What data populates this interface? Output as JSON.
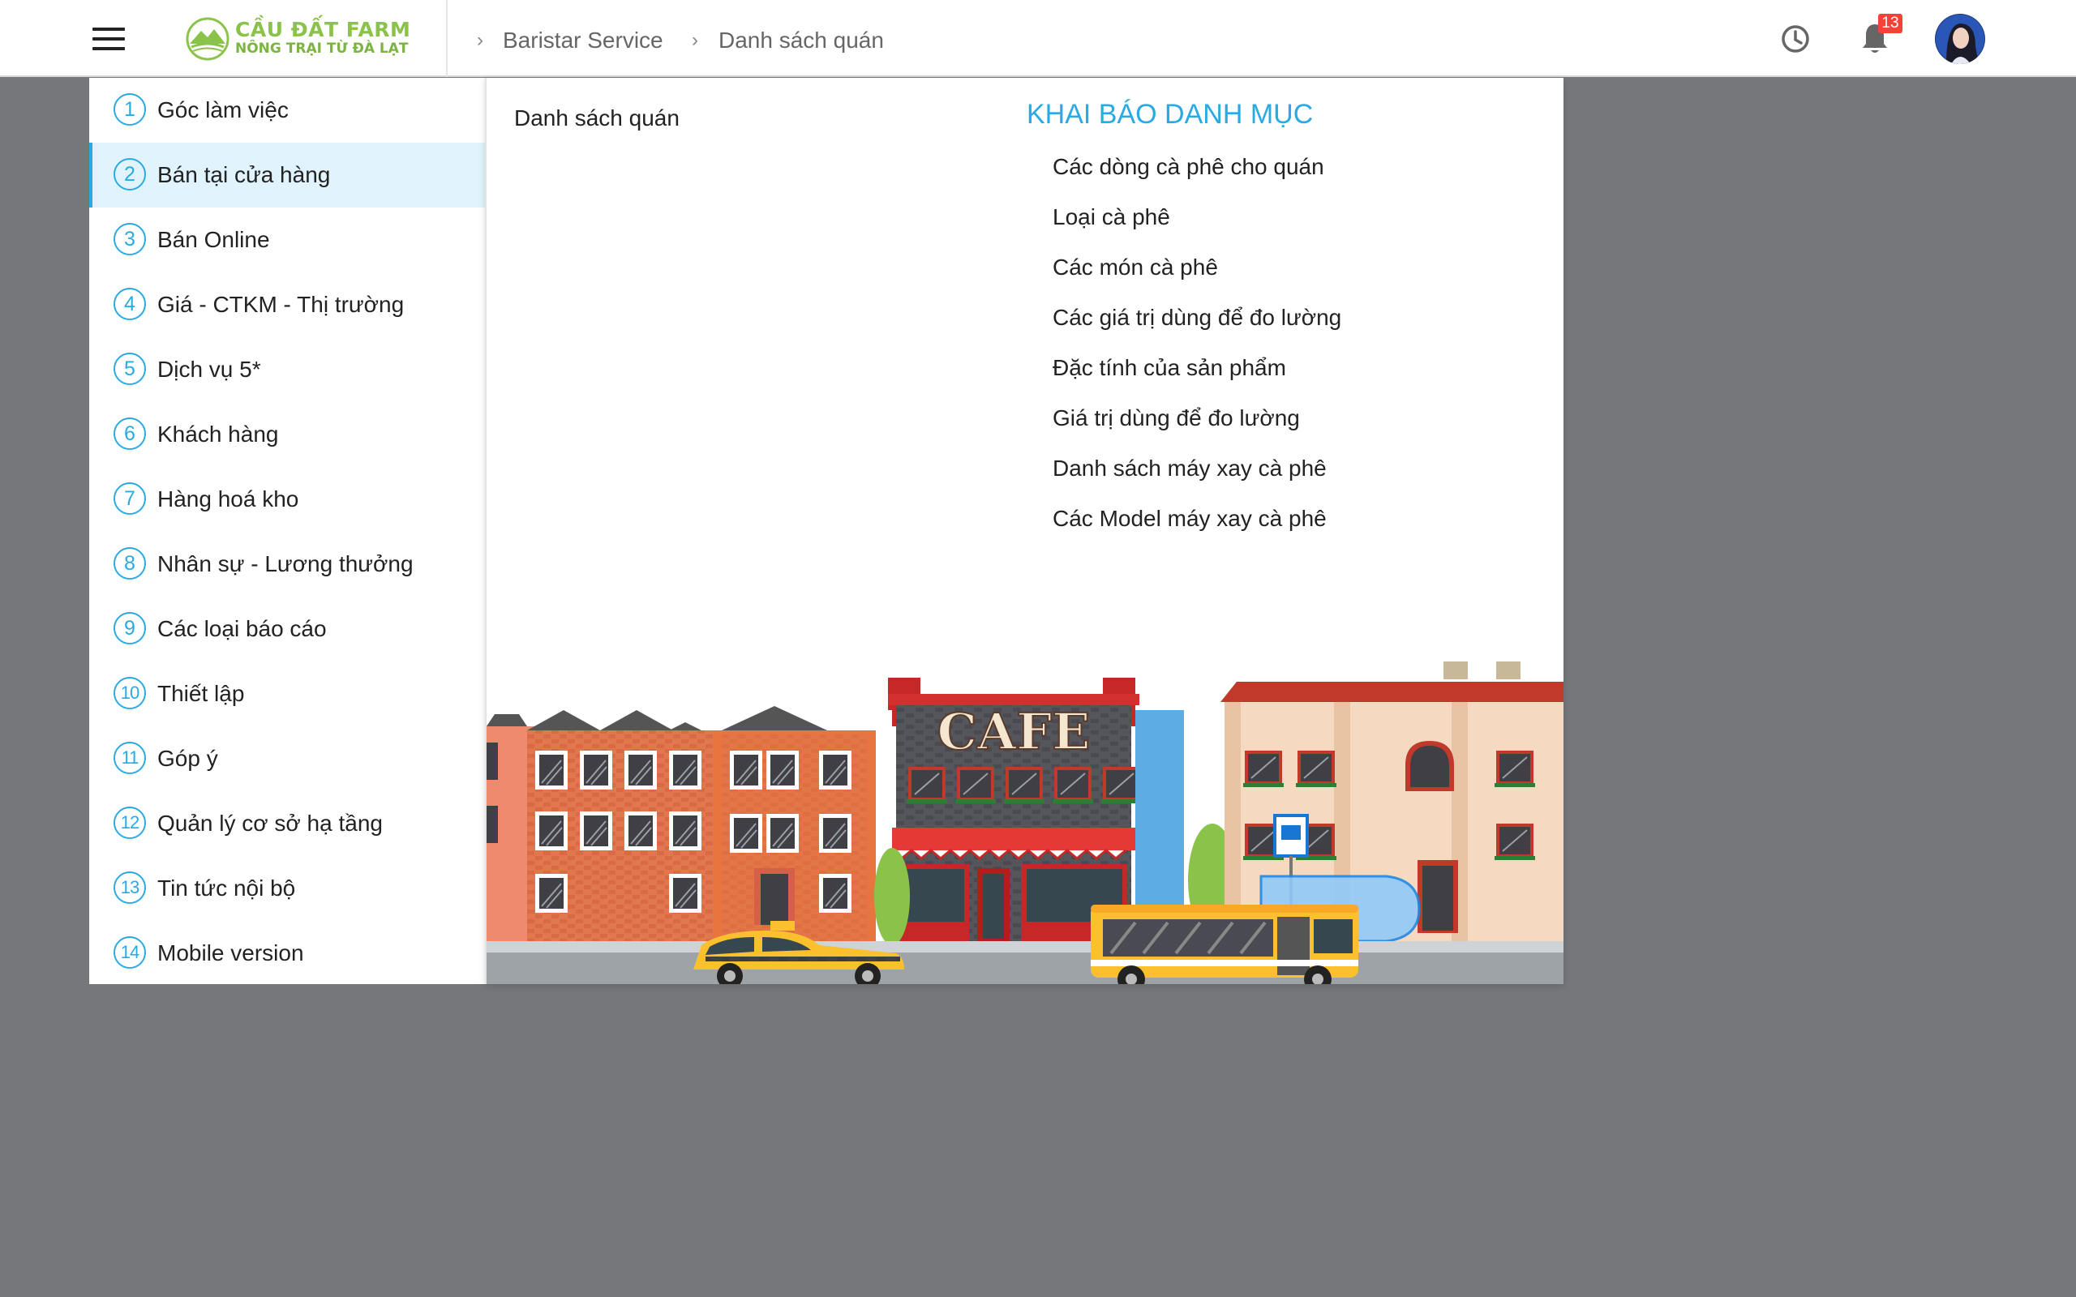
{
  "header": {
    "logo": {
      "name": "CẦU ĐẤT FARM",
      "tagline": "NÔNG TRẠI TỪ ĐÀ LẠT"
    },
    "breadcrumb": [
      "Baristar Service",
      "Danh sách quán"
    ],
    "icons": {
      "menu": "hamburger-menu-icon",
      "history": "clock-icon",
      "notifications": "bell-icon"
    },
    "notification_count": "13",
    "colors": {
      "brand_green": "#8bc34a",
      "badge": "#f44336"
    }
  },
  "sidebar": {
    "accent": "#29abe2",
    "active_index": 1,
    "items": [
      {
        "num": "1",
        "label": "Góc làm việc"
      },
      {
        "num": "2",
        "label": "Bán tại cửa hàng"
      },
      {
        "num": "3",
        "label": "Bán Online"
      },
      {
        "num": "4",
        "label": "Giá - CTKM - Thị trường"
      },
      {
        "num": "5",
        "label": "Dịch vụ 5*"
      },
      {
        "num": "6",
        "label": "Khách hàng"
      },
      {
        "num": "7",
        "label": "Hàng hoá kho"
      },
      {
        "num": "8",
        "label": "Nhân sự - Lương thưởng"
      },
      {
        "num": "9",
        "label": "Các loại báo cáo"
      },
      {
        "num": "10",
        "label": "Thiết lập"
      },
      {
        "num": "11",
        "label": "Góp ý"
      },
      {
        "num": "12",
        "label": "Quản lý cơ sở hạ tầng"
      },
      {
        "num": "13",
        "label": "Tin tức nội bộ"
      },
      {
        "num": "14",
        "label": "Mobile version"
      }
    ]
  },
  "main": {
    "left_link": "Danh sách quán",
    "section_title": "KHAI BÁO DANH MỤC",
    "categories": [
      "Các dòng cà phê cho quán",
      "Loại cà phê",
      "Các món cà phê",
      "Các giá trị dùng để đo lường",
      "Đặc tính của sản phẩm",
      "Giá trị dùng để đo lường",
      "Danh sách máy xay cà phê",
      "Các Model máy xay cà phê"
    ],
    "illustration": {
      "sign": "CAFE"
    }
  }
}
